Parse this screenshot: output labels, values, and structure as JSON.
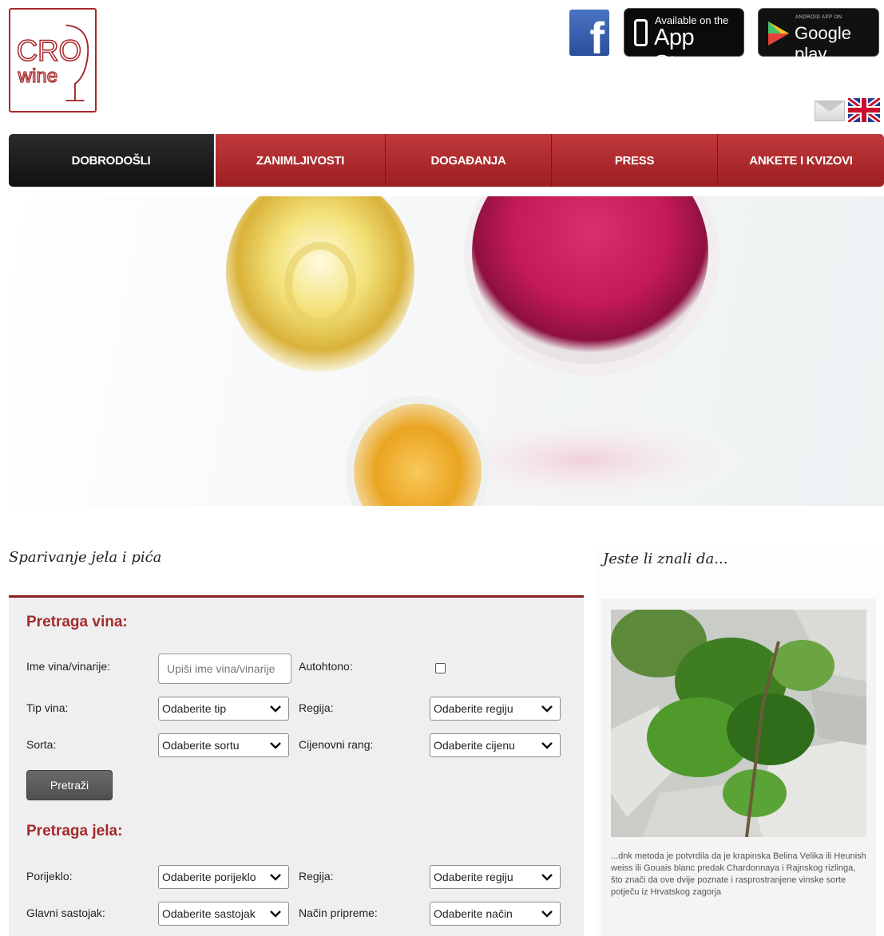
{
  "header": {
    "logo": {
      "line1": "CRO",
      "line2": "wine"
    },
    "store_badges": {
      "facebook_letter": "f",
      "appstore_small": "Available on the",
      "appstore_big": "App Store",
      "googleplay_small": "ANDROID APP ON",
      "googleplay_big": "Google play"
    }
  },
  "nav": {
    "items": [
      {
        "label": "DOBRODOŠLI",
        "active": true
      },
      {
        "label": "ZANIMLJIVOSTI",
        "active": false
      },
      {
        "label": "DOGAĐANJA",
        "active": false
      },
      {
        "label": "PRESS",
        "active": false
      },
      {
        "label": "ANKETE I KVIZOVI",
        "active": false
      }
    ]
  },
  "main": {
    "section_title": "Sparivanje jela i pića",
    "wine_search": {
      "heading": "Pretraga vina:",
      "name_label": "Ime vina/vinarije:",
      "name_placeholder": "Upiši ime vina/vinarije",
      "autochthonous_label": "Autohtono:",
      "autochthonous_checked": false,
      "type_label": "Tip vina:",
      "type_value": "Odaberite tip",
      "region_label": "Regija:",
      "region_value": "Odaberite regiju",
      "variety_label": "Sorta:",
      "variety_value": "Odaberite sortu",
      "price_label": "Cijenovni rang:",
      "price_value": "Odaberite cijenu",
      "search_button": "Pretraži"
    },
    "food_search": {
      "heading": "Pretraga jela:",
      "origin_label": "Porijeklo:",
      "origin_value": "Odaberite porijeklo",
      "region_label": "Regija:",
      "region_value": "Odaberite regiju",
      "ingredient_label": "Glavni sastojak:",
      "ingredient_value": "Odaberite sastojak",
      "method_label": "Način pripreme:",
      "method_value": "Odaberite način"
    }
  },
  "sidebar": {
    "title": "Jeste li znali da...",
    "text": "...dnk metoda je potvrdila da je krapinska Belina Velika ili Heunish weiss ili Gouais blanc predak Chardonnaya i Rajnskog rizlinga, što znači da ove dvije poznate i rasprostranjene vinske sorte potječu iz Hrvatskog zagorja"
  },
  "colors": {
    "brand_red": "#a42a2d",
    "nav_active": "#1a1a1a",
    "panel_bg": "#efefef"
  }
}
